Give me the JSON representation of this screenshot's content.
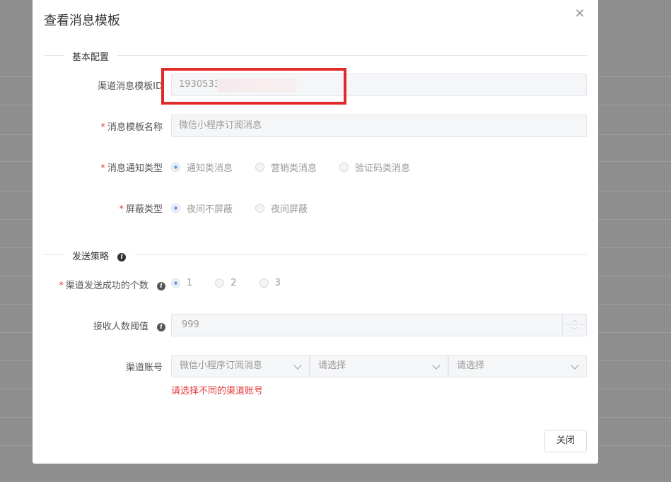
{
  "modal": {
    "title": "查看消息模板",
    "close_label": "关闭"
  },
  "sections": {
    "basic": {
      "title": "基本配置"
    },
    "strategy": {
      "title": "发送策略"
    }
  },
  "fields": {
    "template_id": {
      "label": "渠道消息模板ID",
      "value": "1930533"
    },
    "template_name": {
      "label": "消息模板名称",
      "required": "*",
      "value": "微信小程序订阅消息"
    },
    "notify_type": {
      "label": "消息通知类型",
      "required": "*",
      "options": [
        "通知类消息",
        "营销类消息",
        "验证码类消息"
      ],
      "selected": "通知类消息"
    },
    "shield_type": {
      "label": "屏蔽类型",
      "required": "*",
      "options": [
        "夜间不屏蔽",
        "夜间屏蔽"
      ],
      "selected": "夜间不屏蔽"
    },
    "success_count": {
      "label": "渠道发送成功的个数",
      "required": "*",
      "options": [
        "1",
        "2",
        "3"
      ],
      "selected": "1"
    },
    "receiver_threshold": {
      "label": "接收人数阈值",
      "value": "999"
    },
    "channel_account": {
      "label": "渠道账号",
      "selects": [
        "微信小程序订阅消息",
        "请选择",
        "请选择"
      ],
      "error": "请选择不同的渠道账号"
    }
  },
  "colors": {
    "highlight": "#e12a2a",
    "error": "#e4393c",
    "radio_checked": "#6fa0e8"
  }
}
